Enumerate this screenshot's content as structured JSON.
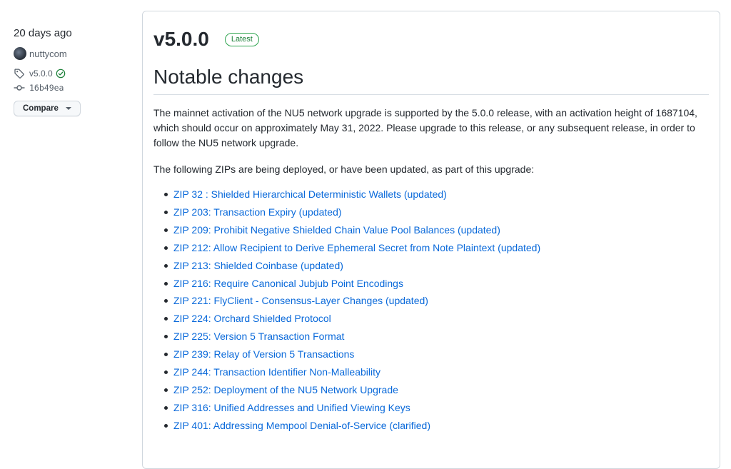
{
  "sidebar": {
    "time_ago": "20 days ago",
    "author": "nuttycom",
    "tag": "v5.0.0",
    "commit": "16b49ea",
    "compare_label": "Compare"
  },
  "release": {
    "version": "v5.0.0",
    "badge": "Latest",
    "heading": "Notable changes",
    "paragraph1": "The mainnet activation of the NU5 network upgrade is supported by the 5.0.0 release, with an activation height of 1687104, which should occur on approximately May 31, 2022. Please upgrade to this release, or any subsequent release, in order to follow the NU5 network upgrade.",
    "paragraph2": "The following ZIPs are being deployed, or have been updated, as part of this upgrade:",
    "zips": [
      "ZIP 32 : Shielded Hierarchical Deterministic Wallets (updated)",
      "ZIP 203: Transaction Expiry (updated)",
      "ZIP 209: Prohibit Negative Shielded Chain Value Pool Balances (updated)",
      "ZIP 212: Allow Recipient to Derive Ephemeral Secret from Note Plaintext (updated)",
      "ZIP 213: Shielded Coinbase (updated)",
      "ZIP 216: Require Canonical Jubjub Point Encodings",
      "ZIP 221: FlyClient - Consensus-Layer Changes (updated)",
      "ZIP 224: Orchard Shielded Protocol",
      "ZIP 225: Version 5 Transaction Format",
      "ZIP 239: Relay of Version 5 Transactions",
      "ZIP 244: Transaction Identifier Non-Malleability",
      "ZIP 252: Deployment of the NU5 Network Upgrade",
      "ZIP 316: Unified Addresses and Unified Viewing Keys",
      "ZIP 401: Addressing Mempool Denial-of-Service (clarified)"
    ]
  },
  "colors": {
    "link": "#0969da",
    "badge_green": "#1a7f37",
    "text": "#24292f",
    "muted": "#57606a"
  },
  "icons": {
    "tag": "tag-icon",
    "commit": "git-commit-icon",
    "verified": "verified-check-icon",
    "caret": "caret-down-icon"
  }
}
